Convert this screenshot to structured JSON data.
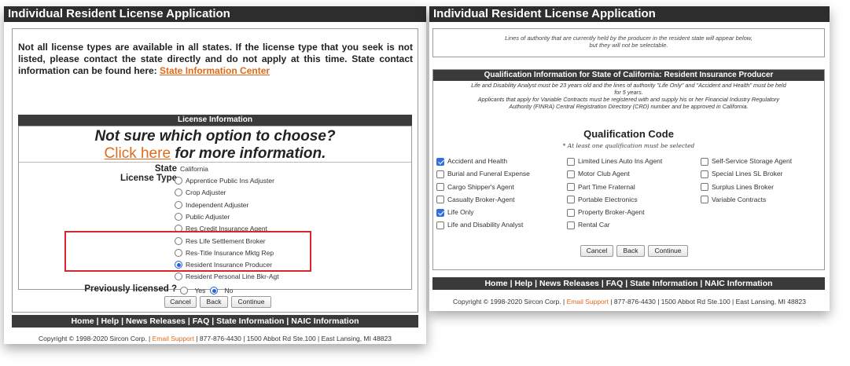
{
  "left": {
    "title": "Individual Resident License Application",
    "notice": "Not all license types are available in all states. If the license type that you seek is not listed, please contact the state directly and do not apply at this time. State contact information can be found here:",
    "notice_link": "State Information Center",
    "section_header": "License Information",
    "not_sure": "Not sure which option to choose?",
    "click_here": "Click here",
    "more_info": "for more information.",
    "state_label": "State",
    "state_value": "California",
    "license_type_label": "License Type",
    "license_types": [
      "Apprentice Public Ins Adjuster",
      "Crop Adjuster",
      "Independent Adjuster",
      "Public Adjuster",
      "Res Credit Insurance Agent",
      "Res Life Settlement Broker",
      "Res-Title Insurance Mktg Rep",
      "Resident Insurance Producer",
      "Resident Personal Line Bkr-Agt"
    ],
    "selected_license_type": "Resident Insurance Producer",
    "prev_licensed_label": "Previously licensed ?",
    "yes_label": "Yes",
    "no_label": "No",
    "prev_licensed_value": "No",
    "buttons": {
      "cancel": "Cancel",
      "back": "Back",
      "continue": "Continue"
    },
    "nav": {
      "home": "Home",
      "help": "Help",
      "news": "News Releases",
      "faq": "FAQ",
      "state_info": "State Information",
      "naic": "NAIC Information",
      "sep": "|"
    },
    "copyright": "Copyright © 1998-2020 Sircon Corp. |",
    "email_support": "Email Support",
    "contact": "| 877-876-4430 | 1500 Abbot Rd Ste.100 | East Lansing, MI 48823"
  },
  "right": {
    "title": "Individual Resident License Application",
    "lines_note_1": "Lines of authority that are currently held by the producer in the resident state will appear below,",
    "lines_note_2": "but they will not be selectable.",
    "qual_header": "Qualification Information for State of California: Resident Insurance Producer",
    "qual_note_1": "Life and Disability Analyst must be 23 years old and the lines of authority \"Life Only\" and \"Accident and Health\" must be held",
    "qual_note_2": "for 5 years.",
    "qual_note_3": "Applicants that apply for Variable Contracts must be registered with and supply his or her Financial Industry Regulatory",
    "qual_note_4": "Authority (FINRA) Central Registration Directory (CRD) number and be approved in California.",
    "qual_code_title": "Qualification Code",
    "at_least_one": "* At least one qualification must be selected",
    "codes_col1": [
      {
        "label": "Accident and Health",
        "checked": true
      },
      {
        "label": "Burial and Funeral Expense",
        "checked": false
      },
      {
        "label": "Cargo Shipper's Agent",
        "checked": false
      },
      {
        "label": "Casualty Broker-Agent",
        "checked": false
      },
      {
        "label": "Life Only",
        "checked": true
      },
      {
        "label": "Life and Disability Analyst",
        "checked": false
      }
    ],
    "codes_col2": [
      {
        "label": "Limited Lines Auto Ins Agent",
        "checked": false
      },
      {
        "label": "Motor Club Agent",
        "checked": false
      },
      {
        "label": "Part Time Fraternal",
        "checked": false
      },
      {
        "label": "Portable Electronics",
        "checked": false
      },
      {
        "label": "Property Broker-Agent",
        "checked": false
      },
      {
        "label": "Rental Car",
        "checked": false
      }
    ],
    "codes_col3": [
      {
        "label": "Self-Service Storage Agent",
        "checked": false
      },
      {
        "label": "Special Lines SL Broker",
        "checked": false
      },
      {
        "label": "Surplus Lines Broker",
        "checked": false
      },
      {
        "label": "Variable Contracts",
        "checked": false
      }
    ],
    "buttons": {
      "cancel": "Cancel",
      "back": "Back",
      "continue": "Continue"
    },
    "nav": {
      "home": "Home",
      "help": "Help",
      "news": "News Releases",
      "faq": "FAQ",
      "state_info": "State Information",
      "naic": "NAIC Information",
      "sep": "|"
    },
    "copyright": "Copyright © 1998-2020 Sircon Corp. |",
    "email_support": "Email Support",
    "contact": "| 877-876-4430 | 1500 Abbot Rd Ste.100 | East Lansing, MI 48823"
  },
  "colors": {
    "dark_bar": "#3a3a3a",
    "link_orange": "#e06a1b",
    "highlight_red": "#d9262b",
    "check_blue": "#2f6fe0"
  }
}
